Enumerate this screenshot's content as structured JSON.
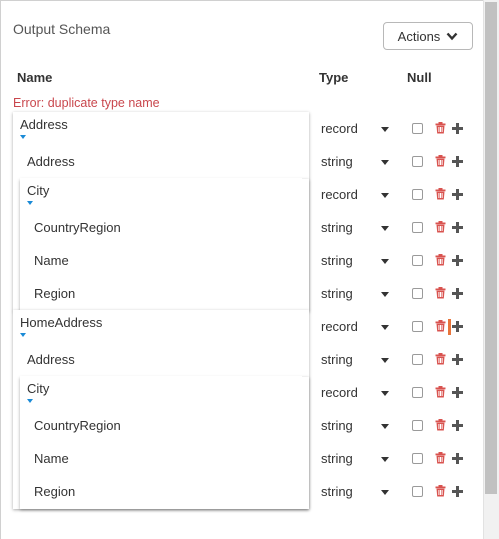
{
  "panel": {
    "title": "Output Schema",
    "actions_label": "Actions",
    "columns": {
      "name": "Name",
      "type": "Type",
      "null": "Null"
    },
    "error": "Error: duplicate type name"
  },
  "rows": [
    {
      "id": "r0",
      "name": "Address",
      "type": "record"
    },
    {
      "id": "r1",
      "name": "Address",
      "type": "string"
    },
    {
      "id": "r2",
      "name": "City",
      "type": "record"
    },
    {
      "id": "r3",
      "name": "CountryRegion",
      "type": "string"
    },
    {
      "id": "r4",
      "name": "Name",
      "type": "string"
    },
    {
      "id": "r5",
      "name": "Region",
      "type": "string"
    },
    {
      "id": "r6",
      "name": "HomeAddress",
      "type": "record"
    },
    {
      "id": "r7",
      "name": "Address",
      "type": "string"
    },
    {
      "id": "r8",
      "name": "City",
      "type": "record"
    },
    {
      "id": "r9",
      "name": "CountryRegion",
      "type": "string"
    },
    {
      "id": "r10",
      "name": "Name",
      "type": "string"
    },
    {
      "id": "r11",
      "name": "Region",
      "type": "string"
    }
  ],
  "colors": {
    "error": "#c9474d",
    "trash": "#d9534f",
    "accent_caret": "#1a8ad6",
    "focus_marker": "#e8743b"
  },
  "icons": {
    "actions": "chevron-down-icon",
    "delete": "trash-icon",
    "add": "plus-icon",
    "expand": "caret-down-icon"
  }
}
